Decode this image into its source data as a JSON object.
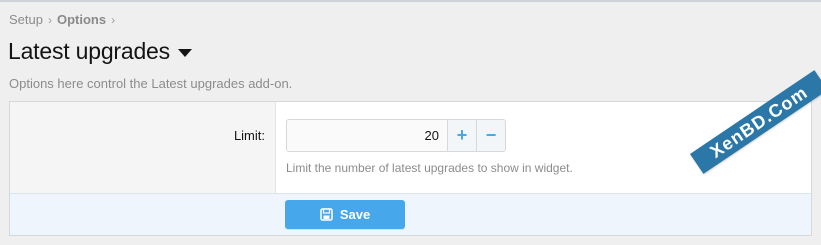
{
  "breadcrumb": {
    "items": [
      "Setup",
      "Options"
    ],
    "separator": "›"
  },
  "page": {
    "title": "Latest upgrades",
    "description": "Options here control the Latest upgrades add-on."
  },
  "form": {
    "field": {
      "label": "Limit:",
      "value": "20",
      "hint": "Limit the number of latest upgrades to show in widget."
    },
    "increment_label": "+",
    "decrement_label": "−",
    "save_label": "Save"
  },
  "icons": {
    "dropdown": "caret-down-icon",
    "save": "floppy-disk-icon"
  },
  "colors": {
    "accent": "#47a7eb",
    "footer_bg": "#eef5fc",
    "watermark": "#2a77a8"
  },
  "watermark": {
    "text": "XenBD.Com"
  }
}
